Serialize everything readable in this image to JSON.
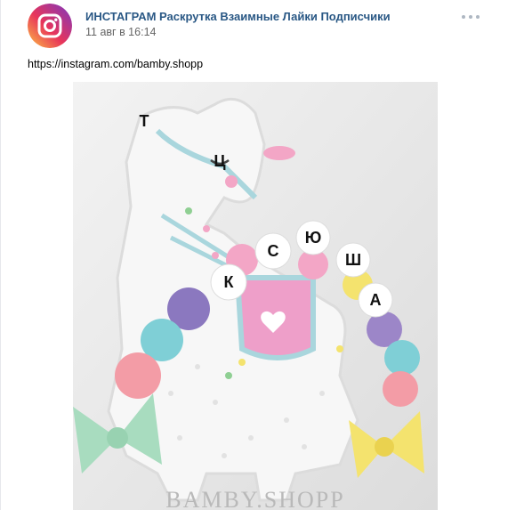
{
  "post": {
    "author": "ИНСТАГРАМ Раскрутка Взаимные Лайки Подписчики",
    "date": "11 авг в 16:14",
    "text": "https://instagram.com/bamby.shopp",
    "avatar_icon": "instagram-logo-icon",
    "menu_icon": "more-options-icon"
  },
  "photo": {
    "beads": [
      "К",
      "С",
      "Ю",
      "Ш",
      "А",
      "Т",
      "Ц"
    ],
    "watermark": "BAMBY.SHOPP"
  },
  "colors": {
    "link": "#2a5885",
    "muted": "#656565"
  }
}
